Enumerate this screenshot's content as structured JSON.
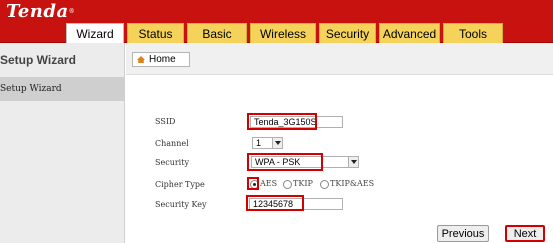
{
  "brand": {
    "logo_text": "Tenda",
    "logo_mark": "®"
  },
  "nav": {
    "tabs": [
      {
        "label": "Wizard",
        "active": true
      },
      {
        "label": "Status",
        "active": false
      },
      {
        "label": "Basic",
        "active": false
      },
      {
        "label": "Wireless",
        "active": false
      },
      {
        "label": "Security",
        "active": false
      },
      {
        "label": "Advanced",
        "active": false
      },
      {
        "label": "Tools",
        "active": false
      }
    ]
  },
  "sidebar": {
    "title": "Setup Wizard",
    "items": [
      {
        "label": "Setup Wizard"
      }
    ]
  },
  "toolbar": {
    "home_label": "Home"
  },
  "form": {
    "ssid": {
      "label": "SSID",
      "value": "Tenda_3G150S"
    },
    "channel": {
      "label": "Channel",
      "value": "1"
    },
    "security": {
      "label": "Security",
      "value": "WPA - PSK"
    },
    "cipher": {
      "label": "Cipher Type",
      "options": [
        "AES",
        "TKIP",
        "TKIP&AES"
      ],
      "selected": "AES"
    },
    "key": {
      "label": "Security Key",
      "value": "12345678"
    }
  },
  "buttons": {
    "previous": "Previous",
    "next": "Next"
  },
  "colors": {
    "header": "#c8120f",
    "tab": "#f5d35a",
    "highlight": "#d40000"
  }
}
